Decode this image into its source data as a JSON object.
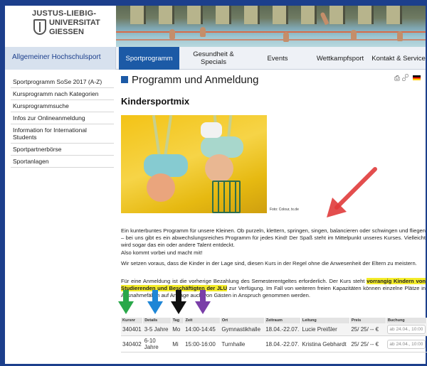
{
  "logo": {
    "line1": "JUSTUS-LIEBIG-",
    "line2": "UNIVERSITAT",
    "line3": "GIESSEN"
  },
  "nav": {
    "home": "Allgemeiner Hochschulsport",
    "items": [
      {
        "label": "Sportprogramm",
        "active": true
      },
      {
        "label": "Gesundheit & Specials",
        "active": false
      },
      {
        "label": "Events",
        "active": false
      },
      {
        "label": "Wettkampfsport",
        "active": false
      },
      {
        "label": "Kontakt & Service",
        "active": false
      }
    ]
  },
  "sidebar": {
    "items": [
      "Sportprogramm SoSe 2017 (A-Z)",
      "Kursprogramm nach Kategorien",
      "Kursprogrammsuche",
      "Infos zur Onlineanmeldung",
      "Information for International Students",
      "Sportpartnerbörse",
      "Sportanlagen"
    ]
  },
  "main": {
    "page_title": "Programm und Anmeldung",
    "course_title": "Kindersportmix",
    "photo_credit": "Foto: Colour, tx.de",
    "para1": "Ein kunterbuntes Programm für unsere Kleinen. Ob purzeln, klettern, springen, singen, balancieren oder schwingen und fliegen – bei uns gibt es ein abwechslungsreiches Programm für jedes Kind! Der Spaß steht im Mittelpunkt unseres Kurses. Vielleicht wird sogar das ein oder andere Talent entdeckt.",
    "para2": "Also kommt vorbei und macht mit!",
    "para3": "Wir setzen voraus, dass die Kinder in der Lage sind, diesen Kurs in der Regel ohne die Anwesenheit der Eltern zu meistern.",
    "para4_a": "Für eine Anmeldung ist die vorherige Bezahlung des Semesterentgeltes erforderlich. Der Kurs steht ",
    "para4_hl": "vorrangig Kindern von Studierenden und Beschäftigten der JLU",
    "para4_b": " zur Verfügung. Im Fall von weiteren freien Kapazitäten können einzelne Plätze in Ausnahmefällen auf Anfrage auch von Gästen in Anspruch genommen werden."
  },
  "table": {
    "headers": [
      "Kursnr",
      "Details",
      "Tag",
      "Zeit",
      "Ort",
      "Zeitraum",
      "Leitung",
      "Preis",
      "Buchung"
    ],
    "rows": [
      {
        "nr": "340401",
        "details": "3-5 Jahre",
        "tag": "Mo",
        "zeit": "14:00-14:45",
        "ort": "Gymnastikhalle",
        "zeitraum": "18.04.-22.07.",
        "leitung": "Lucie Preißler",
        "preis": "25/ 25/ -- €",
        "buchung": "ab 24.04., 10:00"
      },
      {
        "nr": "340402",
        "details": "6-10 Jahre",
        "tag": "Mi",
        "zeit": "15:00-16:00",
        "ort": "Turnhalle",
        "zeitraum": "18.04.-22.07.",
        "leitung": "Kristina Gebhardt",
        "preis": "25/ 25/ -- €",
        "buchung": "ab 24.04., 10:00"
      }
    ]
  },
  "annotations": {
    "arrow_colors": [
      "#2aa84a",
      "#1e86d6",
      "#111111",
      "#7a3ea8"
    ],
    "big_arrow_color": "#e03b3b"
  }
}
